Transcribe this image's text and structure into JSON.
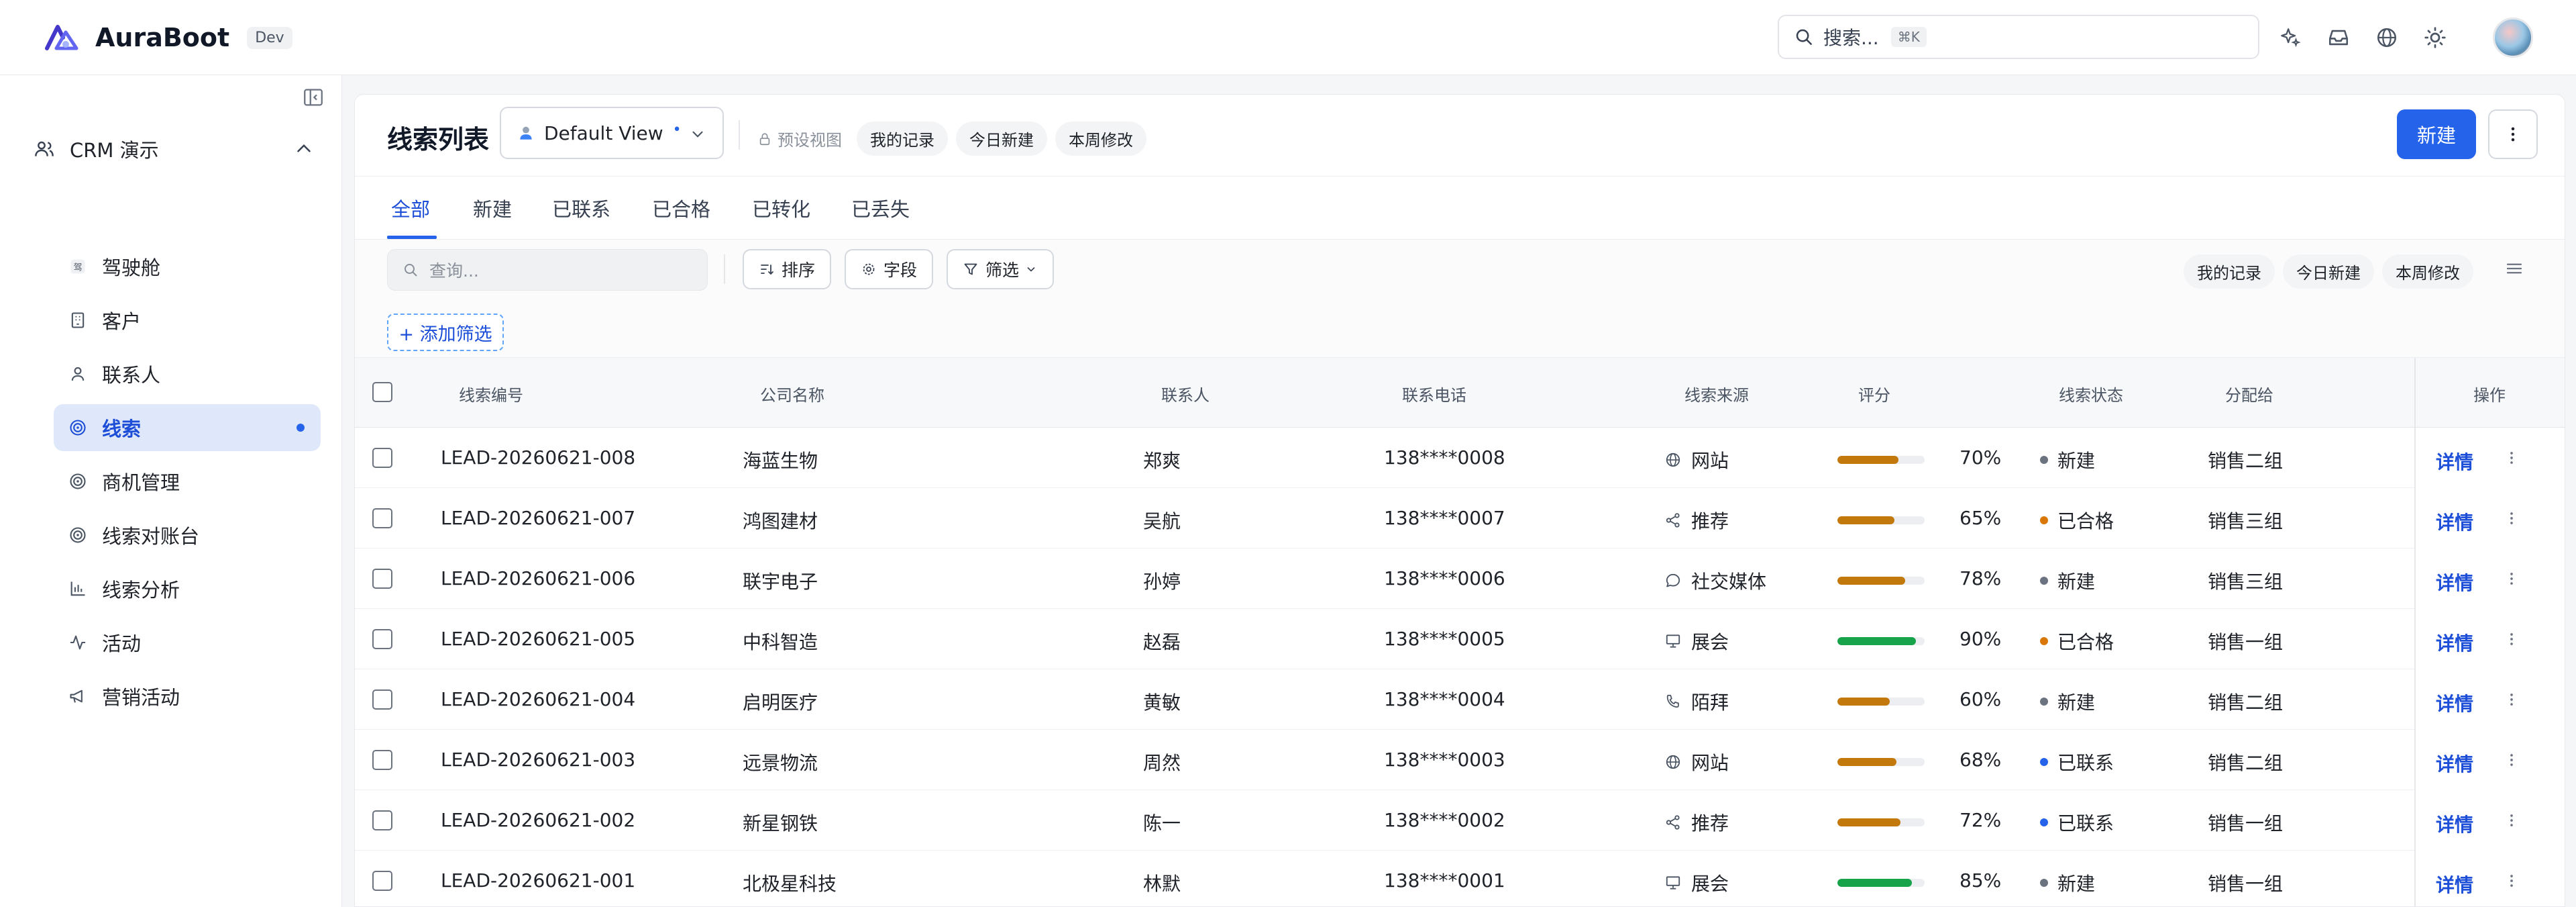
{
  "app": {
    "name": "AuraBoot",
    "env": "Dev"
  },
  "search": {
    "placeholder": "搜索...",
    "shortcut": "⌘K"
  },
  "sidebar": {
    "group": "CRM 演示",
    "items": [
      {
        "label": "驾驶舱",
        "icon": "cockpit-icon"
      },
      {
        "label": "客户",
        "icon": "building-icon"
      },
      {
        "label": "联系人",
        "icon": "person-icon"
      },
      {
        "label": "线索",
        "icon": "target-icon",
        "active": true
      },
      {
        "label": "商机管理",
        "icon": "target-rings-icon"
      },
      {
        "label": "线索对账台",
        "icon": "target-icon"
      },
      {
        "label": "线索分析",
        "icon": "bar-chart-icon"
      },
      {
        "label": "活动",
        "icon": "activity-icon"
      },
      {
        "label": "营销活动",
        "icon": "megaphone-icon"
      }
    ]
  },
  "header": {
    "title": "线索列表",
    "view_name": "Default View",
    "view_dot": "•",
    "preset_label": "预设视图",
    "preset_chips": [
      "我的记录",
      "今日新建",
      "本周修改"
    ],
    "new_label": "新建"
  },
  "tabs": [
    "全部",
    "新建",
    "已联系",
    "已合格",
    "已转化",
    "已丢失"
  ],
  "toolbar": {
    "query_placeholder": "查询...",
    "sort_label": "排序",
    "fields_label": "字段",
    "filter_label": "筛选",
    "right_chips": [
      "我的记录",
      "今日新建",
      "本周修改"
    ],
    "add_filter_label": "+ 添加筛选"
  },
  "table": {
    "columns": [
      "线索编号",
      "公司名称",
      "联系人",
      "联系电话",
      "线索来源",
      "评分",
      "线索状态",
      "分配给",
      "操作"
    ],
    "rows": [
      {
        "id": "LEAD-20260621-008",
        "company": "海蓝生物",
        "contact": "郑爽",
        "phone": "138****0008",
        "source": "网站",
        "source_icon": "globe-icon",
        "score": "70%",
        "score_value": 0.7,
        "status": "新建",
        "status_color": "#6b7280",
        "owner": "销售二组"
      },
      {
        "id": "LEAD-20260621-007",
        "company": "鸿图建材",
        "contact": "吴航",
        "phone": "138****0007",
        "source": "推荐",
        "source_icon": "share-icon",
        "score": "65%",
        "score_value": 0.65,
        "status": "已合格",
        "status_color": "#d97706",
        "owner": "销售三组"
      },
      {
        "id": "LEAD-20260621-006",
        "company": "联宇电子",
        "contact": "孙婷",
        "phone": "138****0006",
        "source": "社交媒体",
        "source_icon": "chat-bubble-icon",
        "score": "78%",
        "score_value": 0.78,
        "status": "新建",
        "status_color": "#6b7280",
        "owner": "销售三组"
      },
      {
        "id": "LEAD-20260621-005",
        "company": "中科智造",
        "contact": "赵磊",
        "phone": "138****0005",
        "source": "展会",
        "source_icon": "presentation-icon",
        "score": "90%",
        "score_value": 0.9,
        "status": "已合格",
        "status_color": "#d97706",
        "owner": "销售一组"
      },
      {
        "id": "LEAD-20260621-004",
        "company": "启明医疗",
        "contact": "黄敏",
        "phone": "138****0004",
        "source": "陌拜",
        "source_icon": "phone-icon",
        "score": "60%",
        "score_value": 0.6,
        "status": "新建",
        "status_color": "#6b7280",
        "owner": "销售二组"
      },
      {
        "id": "LEAD-20260621-003",
        "company": "远景物流",
        "contact": "周然",
        "phone": "138****0003",
        "source": "网站",
        "source_icon": "globe-icon",
        "score": "68%",
        "score_value": 0.68,
        "status": "已联系",
        "status_color": "#2563eb",
        "owner": "销售二组"
      },
      {
        "id": "LEAD-20260621-002",
        "company": "新星钢铁",
        "contact": "陈一",
        "phone": "138****0002",
        "source": "推荐",
        "source_icon": "share-icon",
        "score": "72%",
        "score_value": 0.72,
        "status": "已联系",
        "status_color": "#2563eb",
        "owner": "销售一组"
      },
      {
        "id": "LEAD-20260621-001",
        "company": "北极星科技",
        "contact": "林默",
        "phone": "138****0001",
        "source": "展会",
        "source_icon": "presentation-icon",
        "score": "85%",
        "score_value": 0.85,
        "status": "新建",
        "status_color": "#6b7280",
        "owner": "销售一组"
      }
    ],
    "detail_label": "详情"
  },
  "colors": {
    "accent": "#2563eb",
    "score_mid": "#c2780a",
    "score_high": "#16a34a"
  }
}
